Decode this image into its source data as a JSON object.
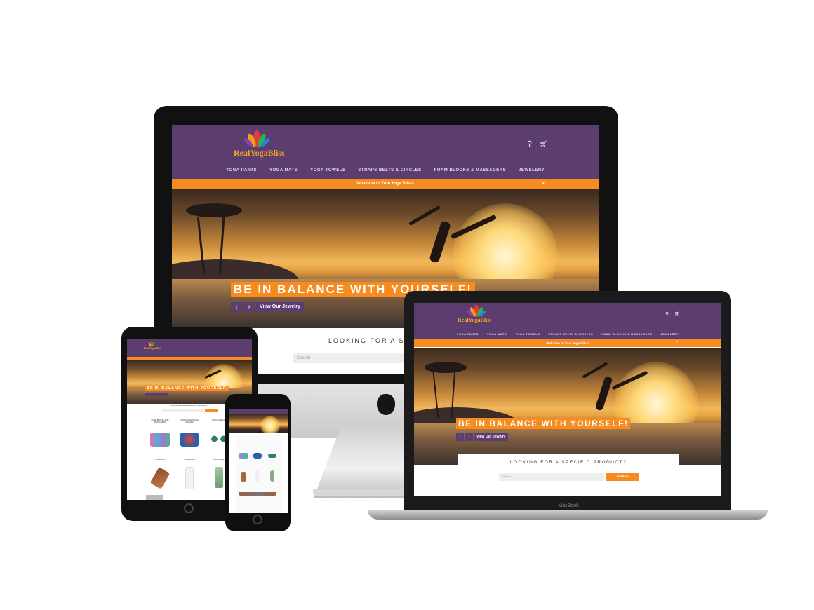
{
  "brand": {
    "name": "RealYogaBliss",
    "accent_purple": "#5b3d70",
    "accent_orange": "#f68b1f"
  },
  "header": {
    "search_icon": "search-icon",
    "cart_icon": "cart-icon"
  },
  "nav": {
    "items": [
      "YOGA PANTS",
      "YOGA MATS",
      "YOGA TOWELS",
      "STRAPS BELTS & CIRCLES",
      "FOAM BLOCKS & MASSAGERS",
      "JEWELERY"
    ]
  },
  "announcement": {
    "text": "Welcome to True Yoga Bliss!",
    "close": "×"
  },
  "hero": {
    "headline": "BE IN BALANCE WITH YOURSELF!",
    "prev": "‹",
    "next": "›",
    "cta": "View Our Jewelry"
  },
  "search_section": {
    "title": "LOOKING FOR A SPECIFIC PRODUCT?",
    "title_cropped": "LOOKING FOR A SPECIF",
    "placeholder": "Search",
    "button": "SEARCH"
  },
  "products": {
    "row1": [
      "FOAM BLOCKS AND MASSAGERS",
      "STRAPS BELTS AND CIRCLES",
      "YOGA JEWELRY"
    ],
    "row2": [
      "YOGA MATS",
      "YOGA PANTS",
      "YOGA TOWELS"
    ]
  },
  "laptop": {
    "label": "MacBook"
  }
}
